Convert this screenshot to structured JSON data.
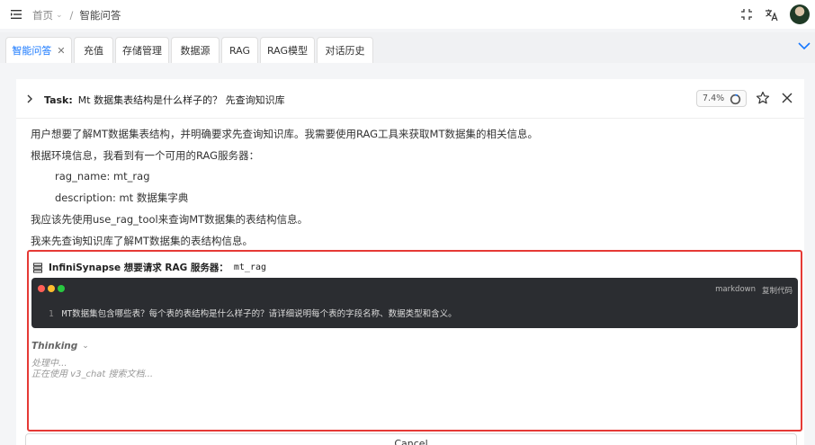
{
  "header": {
    "breadcrumb": {
      "home": "首页",
      "separator": "/",
      "current": "智能问答"
    }
  },
  "tabs": [
    {
      "label": "智能问答",
      "active": true,
      "closable": true
    },
    {
      "label": "充值"
    },
    {
      "label": "存储管理"
    },
    {
      "label": "数据源"
    },
    {
      "label": "RAG"
    },
    {
      "label": "RAG模型"
    },
    {
      "label": "对话历史"
    }
  ],
  "task": {
    "prefix": "Task:",
    "title": "Mt 数据集表结构是什么样子的？ 先查询知识库",
    "progress_text": "7.4%",
    "progress_value": 0.074
  },
  "messages": [
    "用户想要了解MT数据集表结构，并明确要求先查询知识库。我需要使用RAG工具来获取MT数据集的相关信息。",
    "根据环境信息，我看到有一个可用的RAG服务器：",
    "rag_name: mt_rag",
    "description: mt 数据集字典",
    "我应该先使用use_rag_tool来查询MT数据集的表结构信息。",
    "我来先查询知识库了解MT数据集的表结构信息。"
  ],
  "tool_request": {
    "agent": "InfiniSynapse 想要请求 RAG 服务器：",
    "server": "mt_rag",
    "code_lang": "markdown",
    "copy_label": "复制代码",
    "line_number": "1",
    "code": "MT数据集包含哪些表？每个表的表结构是什么样子的？请详细说明每个表的字段名称、数据类型和含义。",
    "thinking_label": "Thinking",
    "thinking_lines": [
      "处理中...",
      "正在使用 v3_chat 搜索文档..."
    ]
  },
  "cancel_label": "Cancel",
  "colors": {
    "accent": "#1677ff",
    "highlight_border": "#e53935",
    "code_bg": "#2b2d31"
  }
}
